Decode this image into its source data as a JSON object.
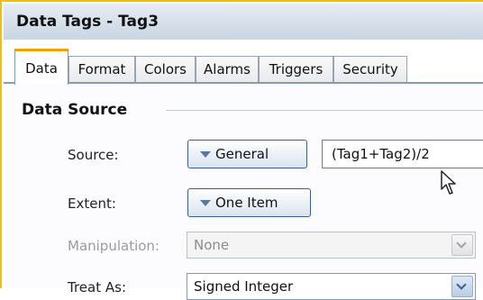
{
  "window": {
    "title": "Data Tags - Tag3"
  },
  "tabs": [
    {
      "label": "Data",
      "active": true
    },
    {
      "label": "Format"
    },
    {
      "label": "Colors"
    },
    {
      "label": "Alarms"
    },
    {
      "label": "Triggers"
    },
    {
      "label": "Security"
    }
  ],
  "data_source": {
    "heading": "Data Source",
    "source": {
      "label": "Source:",
      "button": "General",
      "expression": "(Tag1+Tag2)/2"
    },
    "extent": {
      "label": "Extent:",
      "button": "One Item"
    },
    "manipulation": {
      "label": "Manipulation:",
      "value": "None",
      "enabled": false
    },
    "treat_as": {
      "label": "Treat As:",
      "value": "Signed Integer"
    }
  },
  "colors": {
    "title_accent": "#f2c200",
    "active_tab_accent": "#f2a100"
  },
  "icons": {
    "dropdown": "chevron-down-icon",
    "menu": "triangle-down-icon",
    "pointer": "mouse-cursor-icon"
  }
}
